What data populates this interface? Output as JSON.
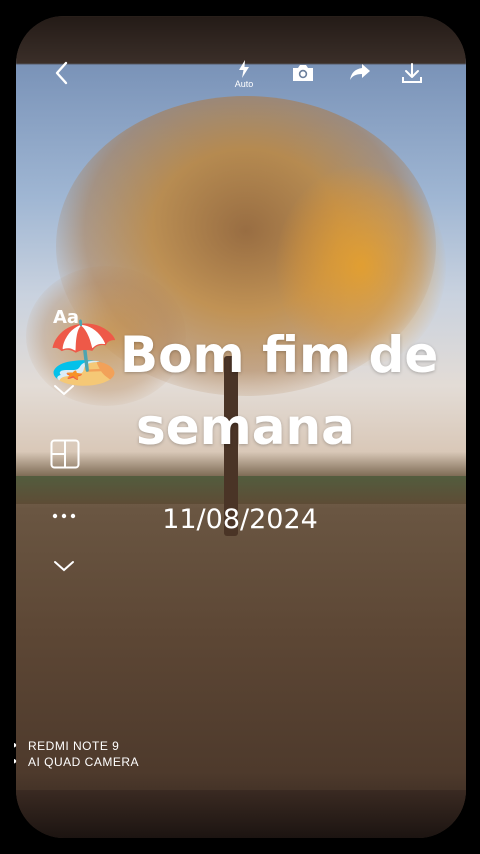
{
  "toolbar": {
    "back_icon": "chevron-left-icon",
    "flash_label": "Auto",
    "flash_icon": "lightning-icon",
    "camera_icon": "camera-icon",
    "share_icon": "share-arrow-icon",
    "download_icon": "download-icon"
  },
  "editor": {
    "text_tool_label": "Aa",
    "sticker_emoji": "🏖️",
    "layout_icon": "layout-grid-icon",
    "more_icon": "more-dots-icon",
    "collapse_icon": "chevron-down-icon"
  },
  "story": {
    "title_line1": "Bom fim de",
    "title_line2": "semana",
    "date": "11/08/2024"
  },
  "watermark": {
    "line1": "REDMI NOTE 9",
    "line2": "AI QUAD CAMERA"
  }
}
